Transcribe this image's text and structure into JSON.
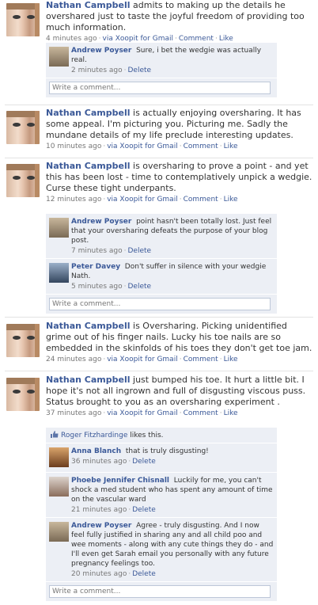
{
  "posts": [
    {
      "author": "Nathan Campbell",
      "text": "admits to making up the details he overshared just to taste the joyful freedom of providing too much information.",
      "time": "4 minutes ago",
      "via": "via Xoopit for Gmail",
      "comment_label": "Comment",
      "like_label": "Like",
      "comments": [
        {
          "author": "Andrew Poyser",
          "text": "Sure, i bet the wedgie was actually real.",
          "time": "2 minutes ago",
          "delete_label": "Delete"
        }
      ],
      "comment_placeholder": "Write a comment..."
    },
    {
      "author": "Nathan Campbell",
      "text": "is actually enjoying oversharing. It has some appeal. I'm picturing you. Picturing me. Sadly the mundane details of my life preclude interesting updates.",
      "time": "10 minutes ago",
      "via": "via Xoopit for Gmail",
      "comment_label": "Comment",
      "like_label": "Like"
    },
    {
      "author": "Nathan Campbell",
      "text": "is oversharing to prove a point - and yet this has been lost - time to contemplatively unpick a wedgie. Curse these tight underpants.",
      "time": "12 minutes ago",
      "via": "via Xoopit for Gmail",
      "comment_label": "Comment",
      "like_label": "Like",
      "comments": [
        {
          "author": "Andrew Poyser",
          "text": "point hasn't been totally lost. Just feel that your oversharing defeats the purpose of your blog post.",
          "time": "7 minutes ago",
          "delete_label": "Delete"
        },
        {
          "author": "Peter Davey",
          "text": "Don't suffer in silence with your wedgie Nath.",
          "time": "5 minutes ago",
          "delete_label": "Delete"
        }
      ],
      "comment_placeholder": "Write a comment..."
    },
    {
      "author": "Nathan Campbell",
      "text": "is Oversharing. Picking unidentified grime out of his finger nails. Lucky his toe nails are so embedded in the skinfolds of his toes they don't get toe jam.",
      "time": "24 minutes ago",
      "via": "via Xoopit for Gmail",
      "comment_label": "Comment",
      "like_label": "Like"
    },
    {
      "author": "Nathan Campbell",
      "text": "just bumped his toe. It hurt a little bit. I hope it's not all ingrown and full of disgusting viscous puss. Status brought to you as an oversharing experiment .",
      "time": "37 minutes ago",
      "via": "via Xoopit for Gmail",
      "comment_label": "Comment",
      "like_label": "Like",
      "likes": {
        "name": "Roger Fitzhardinge",
        "suffix": "likes this."
      },
      "comments": [
        {
          "author": "Anna Blanch",
          "text": "that is truly disgusting!",
          "time": "36 minutes ago",
          "delete_label": "Delete"
        },
        {
          "author": "Phoebe Jennifer Chisnall",
          "text": "Luckily for me, you can't shock a med student who has spent any amount of time on the vascular ward",
          "time": "21 minutes ago",
          "delete_label": "Delete"
        },
        {
          "author": "Andrew Poyser",
          "text": "Agree - truly disgusting. And I now feel fully justified in sharing any and all child poo and wee moments - along with any cute things they do - and I'll even get Sarah email you personally with any future pregnancy feelings too.",
          "time": "20 minutes ago",
          "delete_label": "Delete"
        }
      ],
      "comment_placeholder": "Write a comment..."
    }
  ]
}
